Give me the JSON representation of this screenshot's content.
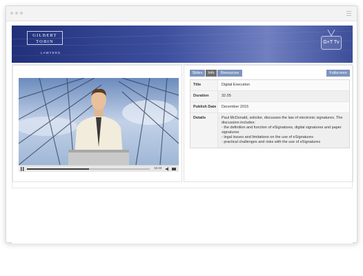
{
  "banner": {
    "logo_line1": "GILBERT",
    "logo_line2": "TOBIN",
    "logo_sub": "LAWYERS",
    "tv_label": "G+T Tv"
  },
  "tabs": [
    {
      "label": "Slides",
      "active": false
    },
    {
      "label": "Info",
      "active": true
    },
    {
      "label": "Resources",
      "active": false
    }
  ],
  "fullscreen_label": "Fullscreen",
  "player": {
    "time": "16:43"
  },
  "info": {
    "title_key": "Title",
    "title_val": "Digital Execution",
    "duration_key": "Duration",
    "duration_val": "32.05",
    "publish_key": "Publish Date",
    "publish_val": "December 2015",
    "details_key": "Details",
    "details_intro": "Paul McDonald, solicitor, discusses the law of electronic signatures. The discussion includes:",
    "details_items": [
      "- the definition and function of eSignatures, digital signatures and paper signatures",
      "- legal issues and limitations on the use of eSignatures",
      "- practical challenges and risks with the use of eSignatures"
    ]
  }
}
